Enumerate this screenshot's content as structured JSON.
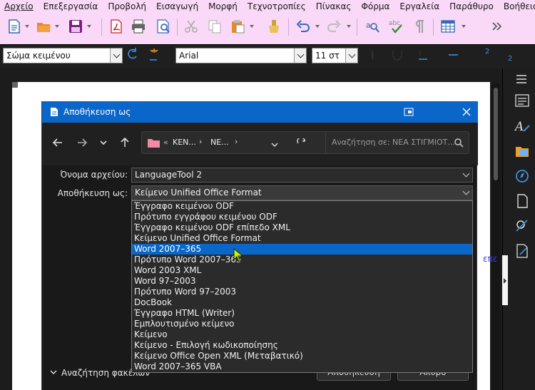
{
  "menu": [
    "Αρχείο",
    "Επεξεργασία",
    "Προβολή",
    "Εισαγωγή",
    "Μορφή",
    "Τεχνοτροπίες",
    "Πίνακας",
    "Φόρμα",
    "Εργαλεία",
    "Παράθυρο",
    "Βοήθεια"
  ],
  "format_toolbar": {
    "paragraph_style": "Σώμα κειμένου",
    "font_name": "Arial",
    "font_size": "11 στ",
    "superscript_label": "2",
    "subscript_label": "2"
  },
  "dialog": {
    "title": "Αποθήκευση ως",
    "path_segment_1": "ΚΕΝ...",
    "path_segment_2": "ΝΕ...",
    "path_prefix": "«",
    "search_placeholder": "Αναζήτηση σε: ΝΕΑ ΣΤΙΓΜΙΟΤ...",
    "filename_label": "Όνομα αρχείου:",
    "filename_value": "LanguageTool 2",
    "saveas_label": "Αποθήκευση ως:",
    "saveas_value": "Κείμενο Unified Office Format",
    "file_types": [
      "Έγγραφο κειμένου ODF",
      "Πρότυπο εγγράφου κειμένου ODF",
      "Έγγραφο κειμένου ODF επίπεδο XML",
      "Κείμενο Unified Office Format",
      "Word 2007–365",
      "Πρότυπο Word 2007–365",
      "Word 2003 XML",
      "Word 97–2003",
      "Πρότυπο Word 97–2003",
      "DocBook",
      "Έγγραφο HTML (Writer)",
      "Εμπλουτισμένο κείμενο",
      "Κείμενο",
      "Κείμενο - Επιλογή κωδικοποίησης",
      "Κείμενο Office Open XML (Μεταβατικό)",
      "Word 2007–365 VBA"
    ],
    "selected_index": 4,
    "browse_folders_label": "Αναζήτηση φακέλων",
    "save_button": "Αποθήκευση",
    "cancel_button": "Άκυρο"
  },
  "doc_fragment": "επε",
  "colors": {
    "menubar_bg": "#f9d9f7",
    "accent": "#0a66c8",
    "dialog_bg": "#202020"
  },
  "icons": [
    "new-document-icon",
    "open-folder-icon",
    "save-icon",
    "export-pdf-icon",
    "print-icon",
    "print-preview-icon",
    "cut-icon",
    "copy-icon",
    "paste-icon",
    "clone-format-icon",
    "undo-icon",
    "redo-icon",
    "find-replace-icon",
    "spellcheck-icon",
    "formatting-marks-icon",
    "insert-table-icon",
    "more-icon",
    "refresh-icon",
    "update-style-icon",
    "new-style-icon",
    "bold-icon",
    "underline-icon",
    "strikethrough-icon",
    "superscript-icon",
    "subscript-icon",
    "properties-icon",
    "styles-icon",
    "gallery-icon",
    "navigator-icon",
    "page-icon",
    "style-inspector-icon",
    "manage-changes-icon"
  ]
}
